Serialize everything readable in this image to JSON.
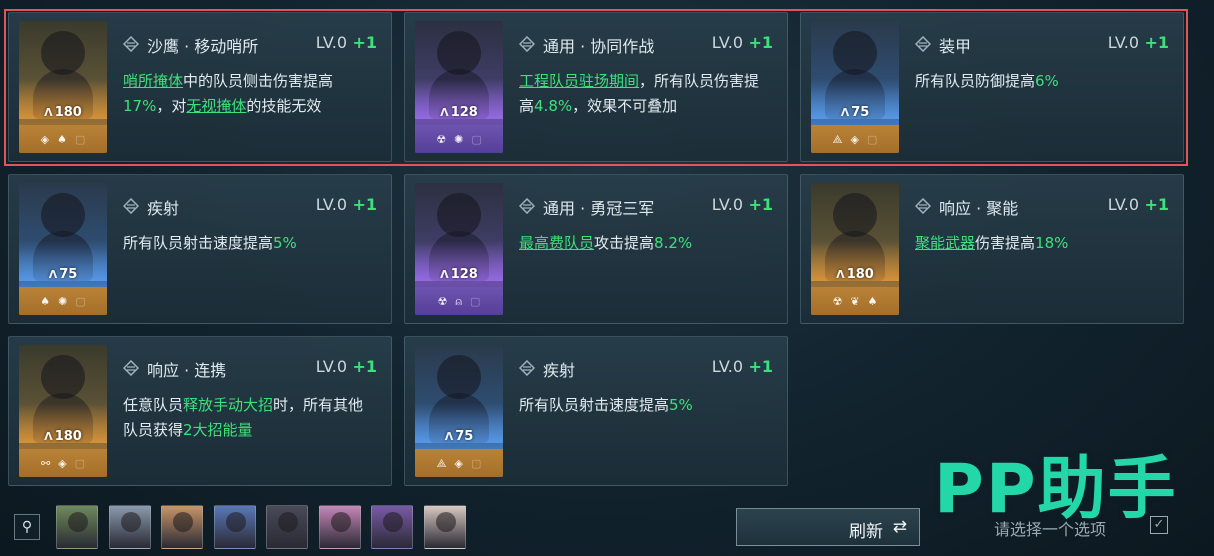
{
  "cards": [
    {
      "name": "沙鹰 · 移动哨所",
      "level": "LV.0",
      "plus": "+1",
      "cost": "180",
      "tier": "gold",
      "icons": [
        "shield-icon",
        "mushroom-icon",
        "square-icon"
      ],
      "desc": [
        {
          "t": "哨所掩体",
          "k": "hl"
        },
        {
          "t": "中的队员侧击伤害提高",
          "k": ""
        },
        {
          "t": "17%",
          "k": "val"
        },
        {
          "t": "，对",
          "k": ""
        },
        {
          "t": "无视掩体",
          "k": "hl"
        },
        {
          "t": "的技能无效",
          "k": ""
        }
      ]
    },
    {
      "name": "通用 · 协同作战",
      "level": "LV.0",
      "plus": "+1",
      "cost": "128",
      "tier": "purple",
      "icons": [
        "radiation-icon",
        "gear-icon",
        "square-icon"
      ],
      "desc": [
        {
          "t": "工程队员驻场期间",
          "k": "hl"
        },
        {
          "t": "，所有队员伤害提高",
          "k": ""
        },
        {
          "t": "4.8%",
          "k": "val"
        },
        {
          "t": "，效果不可叠加",
          "k": ""
        }
      ]
    },
    {
      "name": "装甲",
      "level": "LV.0",
      "plus": "+1",
      "cost": "75",
      "tier": "blue",
      "icons": [
        "triangle-icon",
        "shield-icon",
        "square-icon"
      ],
      "desc": [
        {
          "t": "所有队员防御提高",
          "k": ""
        },
        {
          "t": "6%",
          "k": "val"
        }
      ]
    },
    {
      "name": "疾射",
      "level": "LV.0",
      "plus": "+1",
      "cost": "75",
      "tier": "blue",
      "icons": [
        "mushroom-icon",
        "gear-icon",
        "square-icon"
      ],
      "desc": [
        {
          "t": "所有队员射击速度提高",
          "k": ""
        },
        {
          "t": "5%",
          "k": "val"
        }
      ]
    },
    {
      "name": "通用 · 勇冠三军",
      "level": "LV.0",
      "plus": "+1",
      "cost": "128",
      "tier": "purple",
      "icons": [
        "radiation-icon",
        "helmet-icon",
        "square-icon"
      ],
      "desc": [
        {
          "t": "最高费队员",
          "k": "hl"
        },
        {
          "t": "攻击提高",
          "k": ""
        },
        {
          "t": "8.2%",
          "k": "val"
        }
      ]
    },
    {
      "name": "响应 · 聚能",
      "level": "LV.0",
      "plus": "+1",
      "cost": "180",
      "tier": "gold",
      "icons": [
        "radiation-icon",
        "wings-icon",
        "mushroom-icon"
      ],
      "desc": [
        {
          "t": "聚能武器",
          "k": "hl"
        },
        {
          "t": "伤害提高",
          "k": ""
        },
        {
          "t": "18%",
          "k": "val"
        }
      ]
    },
    {
      "name": "响应 · 连携",
      "level": "LV.0",
      "plus": "+1",
      "cost": "180",
      "tier": "gold",
      "icons": [
        "link-icon",
        "shield-icon",
        "square-icon"
      ],
      "desc": [
        {
          "t": "任意队员",
          "k": ""
        },
        {
          "t": "释放手动大招",
          "k": "val"
        },
        {
          "t": "时，所有其他队员获得",
          "k": ""
        },
        {
          "t": "2大招能量",
          "k": "val"
        }
      ]
    },
    {
      "name": "疾射",
      "level": "LV.0",
      "plus": "+1",
      "cost": "75",
      "tier": "blue",
      "icons": [
        "triangle-icon",
        "shield-icon",
        "square-icon"
      ],
      "desc": [
        {
          "t": "所有队员射击速度提高",
          "k": ""
        },
        {
          "t": "5%",
          "k": "val"
        }
      ]
    }
  ],
  "thumbs": [
    "#6f8a5a",
    "#8a9aac",
    "#c99568",
    "#5a78b8",
    "#4a4a58",
    "#c687b8",
    "#7a5aa8",
    "#d8c8c0"
  ],
  "refresh_label": "刷新",
  "refresh_icon": "⇄",
  "hint": "请选择一个选项",
  "watermark": "PP助手",
  "colors": {
    "accent": "#3ee07a",
    "selection": "#e0545a",
    "watermark": "#23d7a8"
  }
}
